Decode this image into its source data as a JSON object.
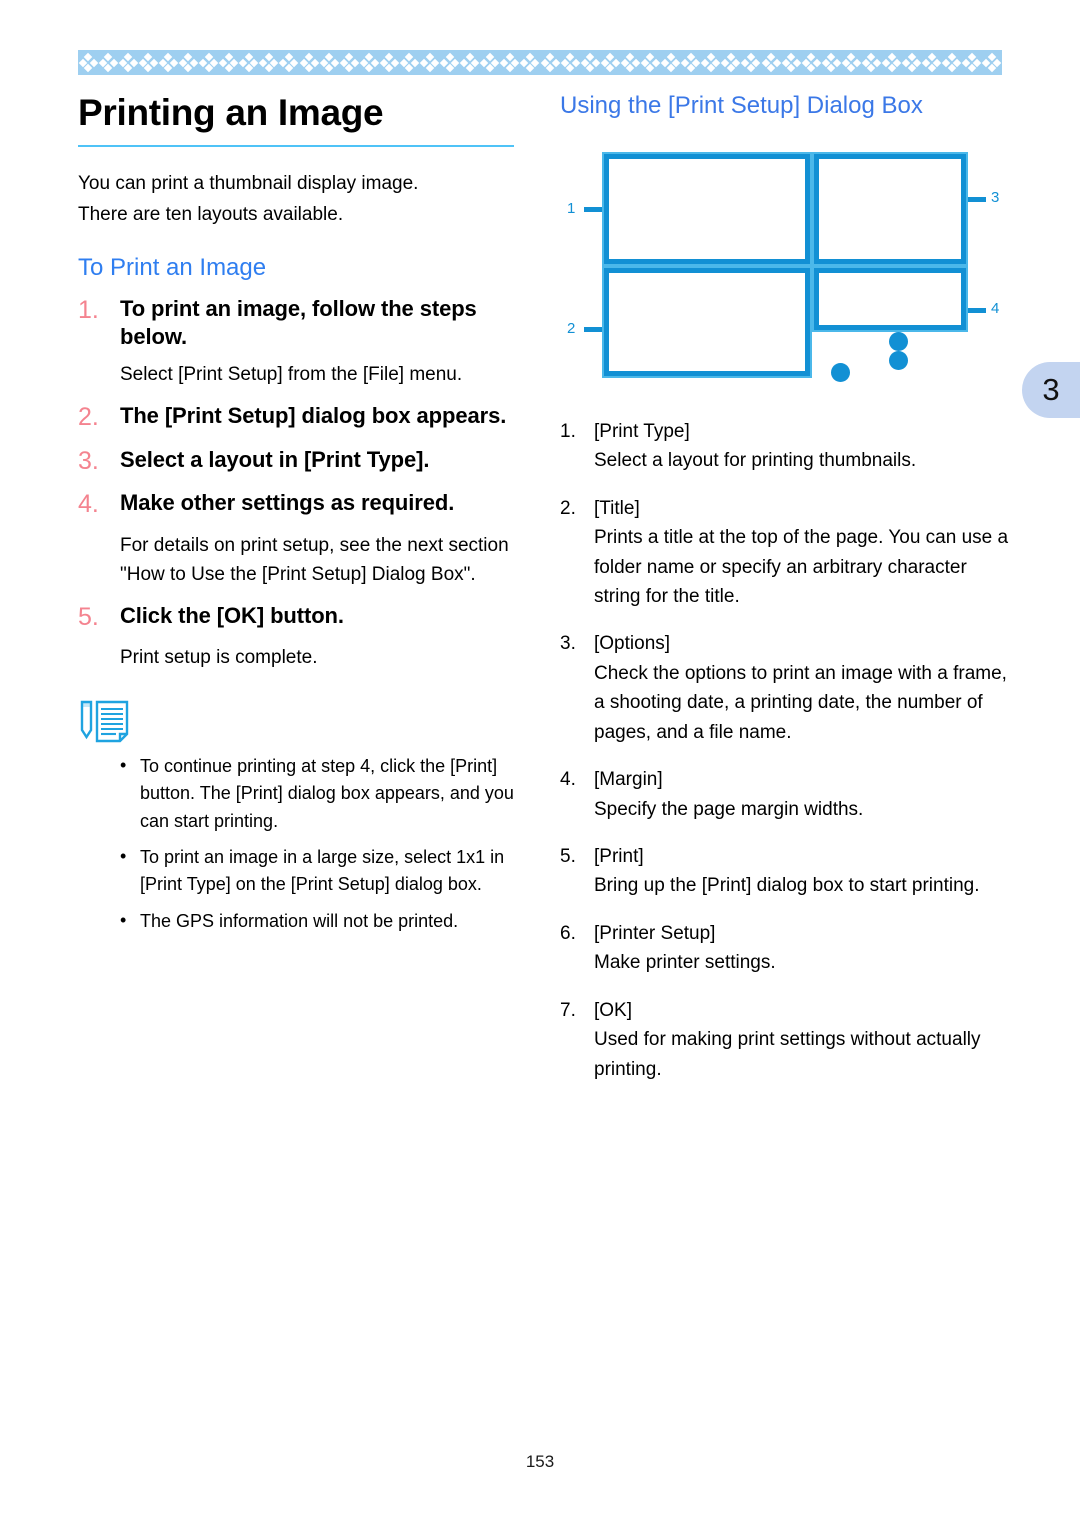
{
  "decoration": {
    "band_color": "#9ecff0",
    "motif_color": "#ffffff",
    "motif_name": "four-diamond-cluster",
    "motif_count": 46
  },
  "chapter_tab": {
    "label": "3",
    "color": "#c3d4f0"
  },
  "left_column": {
    "title": "Printing an Image",
    "rule_color": "#4fc3f7",
    "intro": [
      "You can print a thumbnail display image.",
      "There are ten layouts available."
    ],
    "section_heading": "To Print an Image",
    "section_heading_color": "#3b78e7",
    "step_number_color": "#f4838f",
    "steps": [
      {
        "num": "1.",
        "text": "To print an image, follow the steps below.",
        "body": "Select [Print Setup] from the [File] menu."
      },
      {
        "num": "2.",
        "text": "The [Print Setup] dialog box appears.",
        "body": ""
      },
      {
        "num": "3.",
        "text": "Select a layout in [Print Type].",
        "body": ""
      },
      {
        "num": "4.",
        "text": "Make other settings as required.",
        "body": "For details on print setup, see the next section \"How to Use the [Print Setup] Dialog Box\"."
      },
      {
        "num": "5.",
        "text": "Click the [OK] button.",
        "body": "Print setup is complete."
      }
    ],
    "note_icon": "memo-pencil-icon",
    "notes": [
      "To continue printing at step 4, click the [Print] button. The [Print] dialog box appears, and you can start printing.",
      "To print an image in a large size, select 1x1 in [Print Type] on the [Print Setup] dialog box.",
      "The GPS information will not be printed."
    ]
  },
  "right_column": {
    "heading": "Using the [Print Setup] Dialog Box",
    "heading_color": "#2f7ef0",
    "diagram": {
      "name": "print-setup-dialog-diagram",
      "line_color": "#1290d4",
      "callouts": [
        "1",
        "2",
        "3",
        "4"
      ],
      "dot_count": 3
    },
    "items": [
      {
        "num": "1.",
        "term": "[Print Type]",
        "desc": "Select a layout for printing thumbnails."
      },
      {
        "num": "2.",
        "term": "[Title]",
        "desc": "Prints a title at the top of the page. You can use a folder name or specify an arbitrary character string for the title."
      },
      {
        "num": "3.",
        "term": "[Options]",
        "desc": "Check the options to print an image with a frame, a shooting date, a printing date, the number of pages, and a file name."
      },
      {
        "num": "4.",
        "term": "[Margin]",
        "desc": "Specify the page margin widths."
      },
      {
        "num": "5.",
        "term": "[Print]",
        "desc": "Bring up the [Print] dialog box to start printing."
      },
      {
        "num": "6.",
        "term": "[Printer Setup]",
        "desc": "Make printer settings."
      },
      {
        "num": "7.",
        "term": "[OK]",
        "desc": "Used for making print settings without actually printing."
      }
    ]
  },
  "footer": {
    "page_number": "153"
  }
}
